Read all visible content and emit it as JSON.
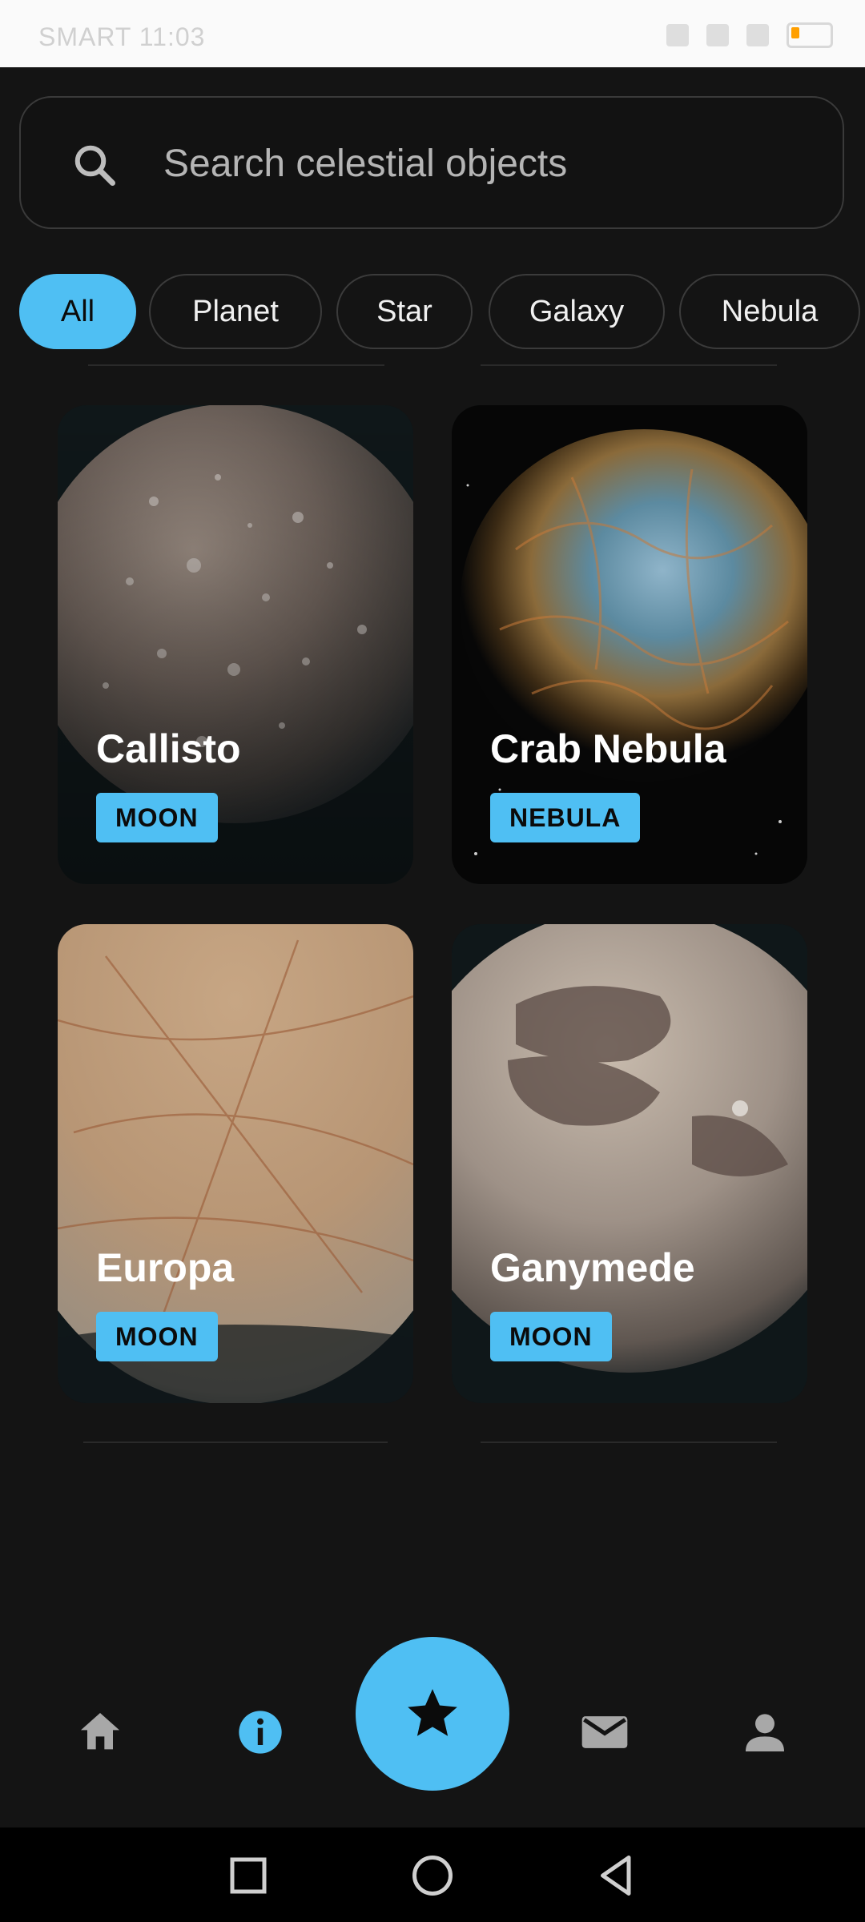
{
  "status_bar": {
    "left_text": "SMART 11:03",
    "battery_color": "#ff9f00"
  },
  "search": {
    "placeholder": "Search celestial objects",
    "value": "",
    "icon": "search-icon"
  },
  "filters": [
    {
      "label": "All",
      "active": true
    },
    {
      "label": "Planet",
      "active": false
    },
    {
      "label": "Star",
      "active": false
    },
    {
      "label": "Galaxy",
      "active": false
    },
    {
      "label": "Nebula",
      "active": false
    }
  ],
  "cards": [
    {
      "name": "Callisto",
      "badge": "MOON"
    },
    {
      "name": "Crab Nebula",
      "badge": "NEBULA"
    },
    {
      "name": "Europa",
      "badge": "MOON"
    },
    {
      "name": "Ganymede",
      "badge": "MOON"
    }
  ],
  "bottom_nav": {
    "items": [
      {
        "icon": "home-icon",
        "active": false
      },
      {
        "icon": "info-icon",
        "active": true
      },
      {
        "icon": "star-icon",
        "active": false
      },
      {
        "icon": "mail-icon",
        "active": false
      },
      {
        "icon": "person-icon",
        "active": false
      }
    ]
  },
  "system_nav": {
    "items": [
      "recent-apps-icon",
      "home-circle-icon",
      "back-triangle-icon"
    ]
  },
  "colors": {
    "accent": "#4fbff3",
    "background": "#141414",
    "chip_border": "#3b3b3b",
    "text_primary": "#ffffff",
    "icon_gray": "#9e9e9e"
  }
}
